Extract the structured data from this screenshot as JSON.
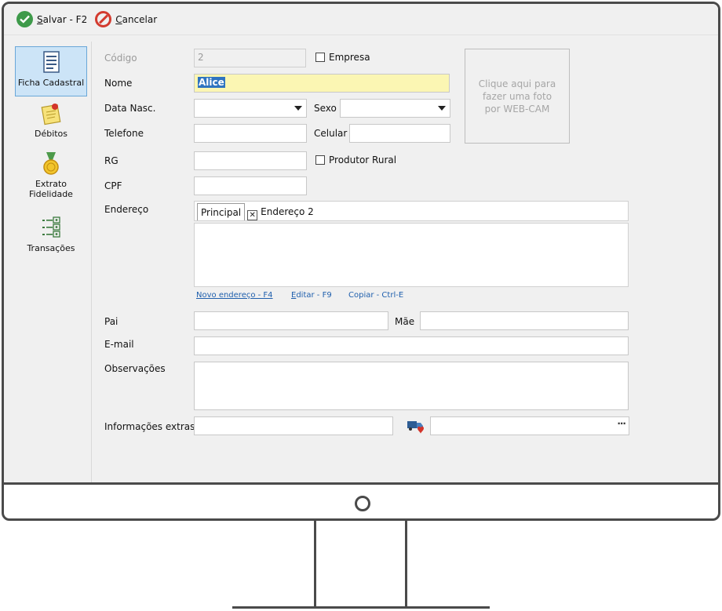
{
  "toolbar": {
    "save_label": "alvar - F2",
    "save_accel": "S",
    "cancel_label": "ancelar",
    "cancel_accel": "C"
  },
  "sidebar": {
    "items": [
      {
        "label": "Ficha Cadastral",
        "icon": "form-document-icon",
        "active": true
      },
      {
        "label": "Débitos",
        "icon": "note-pin-icon",
        "active": false
      },
      {
        "label": "Extrato Fidelidade",
        "icon": "medal-icon",
        "active": false
      },
      {
        "label": "Transações",
        "icon": "transactions-list-icon",
        "active": false
      }
    ]
  },
  "form": {
    "codigo_label": "Código",
    "codigo_value": "2",
    "empresa_label": "Empresa",
    "nome_label": "Nome",
    "nome_value": "Alice",
    "data_nasc_label": "Data Nasc.",
    "sexo_label": "Sexo",
    "telefone_label": "Telefone",
    "celular_label": "Celular",
    "rg_label": "RG",
    "produtor_rural_label": "Produtor Rural",
    "cpf_label": "CPF",
    "endereco_label": "Endereço",
    "address_tabs": [
      "Principal",
      "Endereço 2"
    ],
    "novo_endereco": "Novo endereço - F4",
    "editar": "ditar - F9",
    "editar_accel": "E",
    "copiar": "Copiar - Ctrl-E",
    "pai_label": "Pai",
    "mae_label": "Mãe",
    "email_label": "E-mail",
    "observacoes_label": "Observações",
    "informacoes_extras_label": "Informações extras",
    "photo_text": "Clique aqui para fazer uma foto por WEB-CAM",
    "ellipsis": "···"
  },
  "colors": {
    "accent": "#3e9a4a",
    "cancel": "#d33b2f",
    "selection": "#2f74c0",
    "highlight_field": "#fbf6b3",
    "link": "#1f5fad"
  }
}
